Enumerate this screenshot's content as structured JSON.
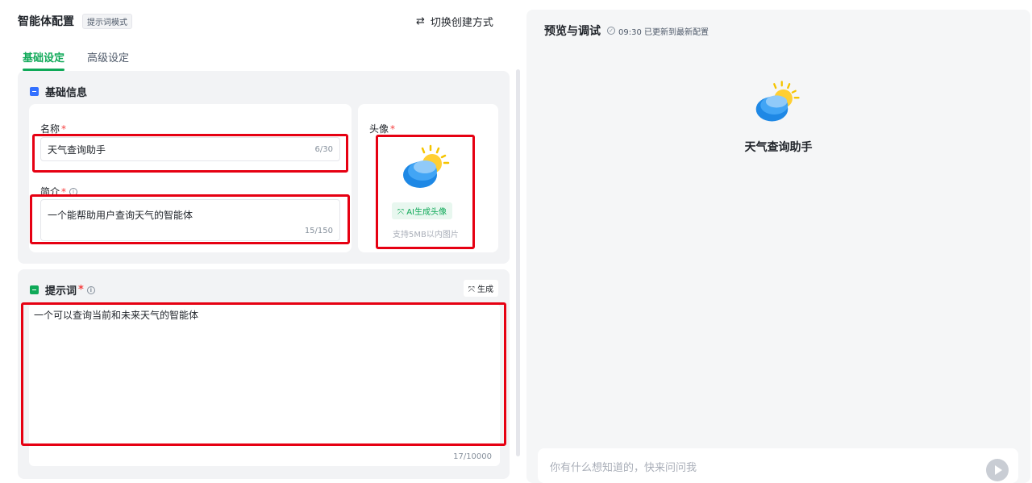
{
  "header": {
    "title": "智能体配置",
    "mode_tag": "提示词模式",
    "switch_label": "切换创建方式",
    "switch_icon": "swap-icon"
  },
  "tabs": [
    {
      "label": "基础设定",
      "active": true
    },
    {
      "label": "高级设定",
      "active": false
    }
  ],
  "basic_info": {
    "title": "基础信息",
    "name_label": "名称",
    "name_value": "天气查询助手",
    "name_count": "6/30",
    "desc_label": "简介",
    "desc_value": "一个能帮助用户查询天气的智能体",
    "desc_count": "15/150",
    "avatar_label": "头像",
    "avatar_gen_label": "AI生成头像",
    "avatar_tip": "支持5MB以内图片",
    "required_mark": "*"
  },
  "prompt": {
    "title": "提示词",
    "generate_label": "生成",
    "value": "一个可以查询当前和未来天气的智能体",
    "count": "17/10000"
  },
  "preview": {
    "title": "预览与调试",
    "status": "09:30 已更新到最新配置",
    "agent_name": "天气查询助手",
    "input_placeholder": "你有什么想知道的，快来问问我"
  },
  "colors": {
    "accent_green": "#0fa958",
    "annotation_red": "#e60012",
    "icon_blue": "#3370ff"
  }
}
